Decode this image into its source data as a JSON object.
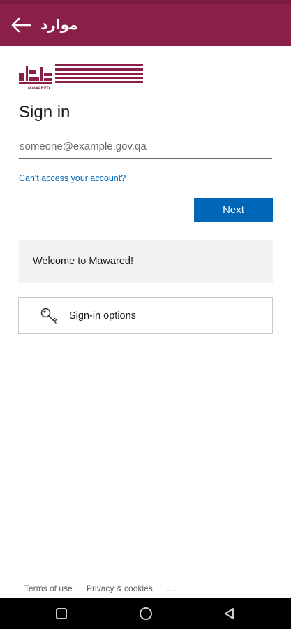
{
  "app_bar": {
    "title": "موارد",
    "back_icon": "arrow-left-icon",
    "color": "#8a1f47"
  },
  "logo": {
    "arabic_text": "موارد",
    "latin_text": "MAWARED",
    "color": "#8a1f47"
  },
  "signin": {
    "title": "Sign in",
    "email_placeholder": "someone@example.gov.qa",
    "email_value": "",
    "cant_access_link": "Can't access your account?",
    "next_button": "Next",
    "accent_color": "#0067b8"
  },
  "welcome": {
    "text": "Welcome to Mawared!"
  },
  "signin_options": {
    "label": "Sign-in options",
    "icon": "key-icon"
  },
  "footer": {
    "terms": "Terms of use",
    "privacy": "Privacy & cookies",
    "more": "..."
  },
  "nav_bar": {
    "icons": [
      "recents-square-icon",
      "home-circle-icon",
      "back-triangle-icon"
    ]
  }
}
